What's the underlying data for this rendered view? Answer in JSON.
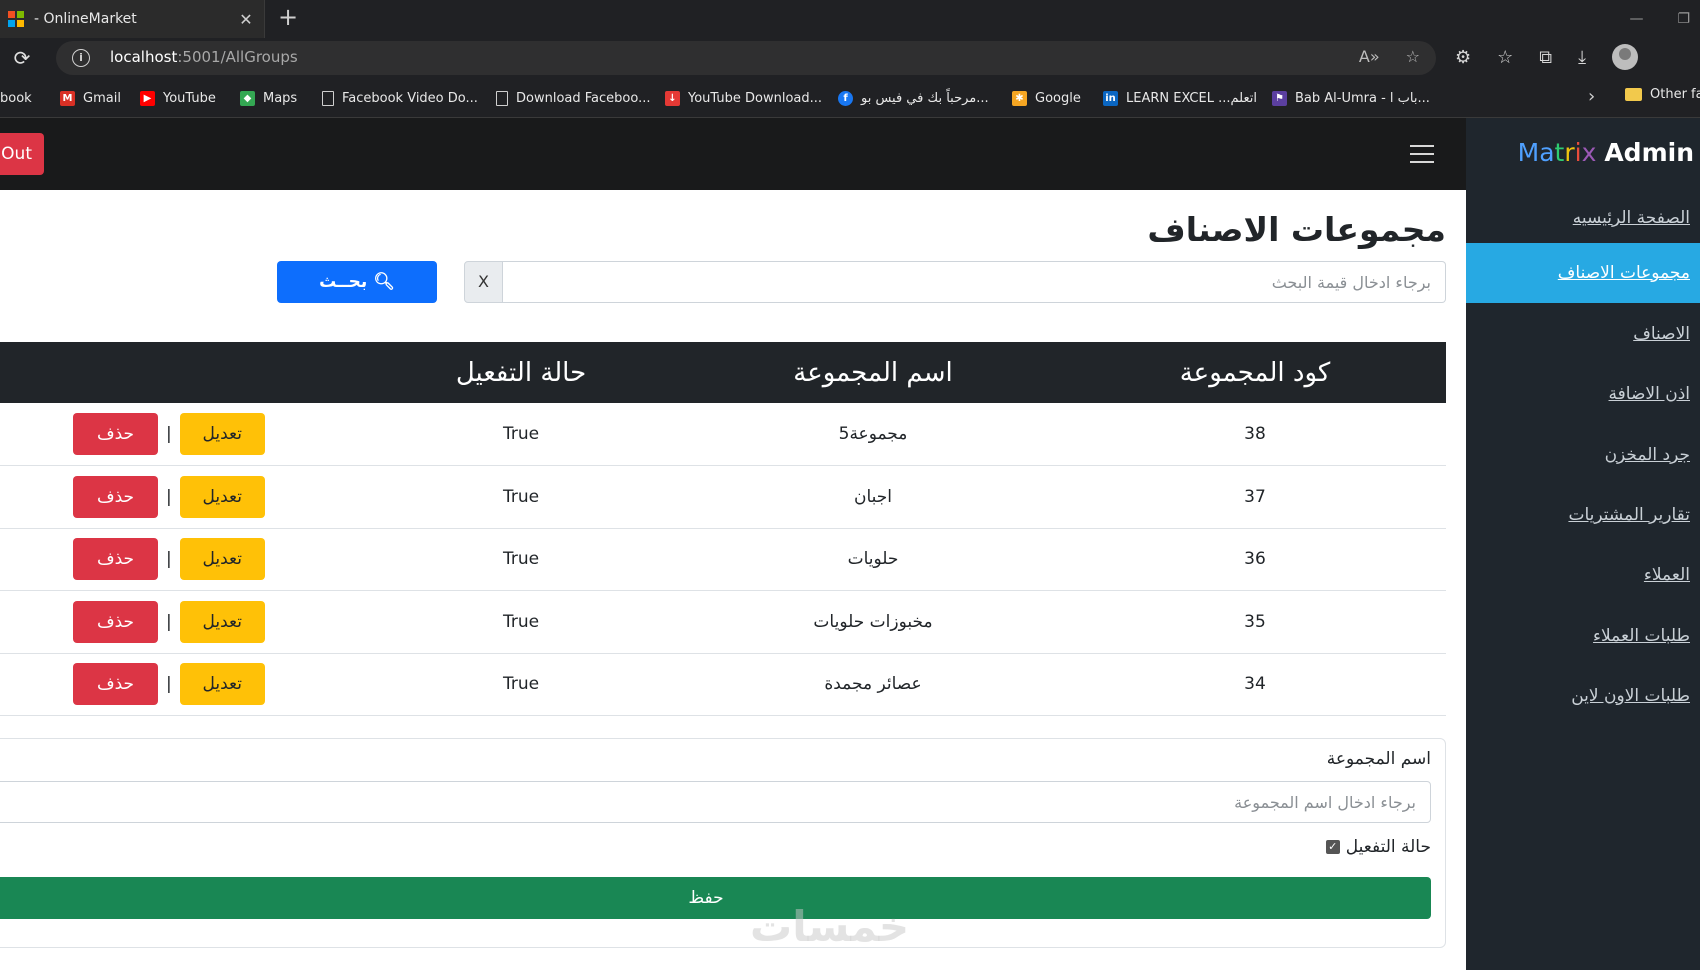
{
  "browser": {
    "tab_title": "- OnlineMarket",
    "tab_close": "✕",
    "new_tab": "+",
    "url_host": "localhost",
    "url_path": ":5001/AllGroups",
    "bookmarks": [
      {
        "label": "ebook",
        "icon": "facebook-icon"
      },
      {
        "label": "Gmail",
        "icon": "gmail-icon"
      },
      {
        "label": "YouTube",
        "icon": "youtube-icon"
      },
      {
        "label": "Maps",
        "icon": "maps-icon"
      },
      {
        "label": "Facebook Video Do...",
        "icon": "page-icon"
      },
      {
        "label": "Download Faceboo...",
        "icon": "page-icon"
      },
      {
        "label": "YouTube Download...",
        "icon": "download-icon"
      },
      {
        "label": "مرحباً بك في فيس بو...",
        "icon": "facebook-icon"
      },
      {
        "label": "Google",
        "icon": "google-icon"
      },
      {
        "label": "LEARN EXCEL ...اتعلم",
        "icon": "linkedin-icon"
      },
      {
        "label": "Bab Al-Umra - باب ا...",
        "icon": "page-icon"
      }
    ],
    "other_favorites": "Other fa"
  },
  "topnav": {
    "logout_label": "LogOut"
  },
  "sidebar": {
    "brand_letters": [
      "M",
      "a",
      "t",
      "r",
      "i",
      "x"
    ],
    "brand_admin": "Admin",
    "items": [
      {
        "label": "الصفحة الرئيسيه"
      },
      {
        "label": "مجموعات الاصناف"
      },
      {
        "label": "الاصناف"
      },
      {
        "label": "اذن الاضافة"
      },
      {
        "label": "جرد المخزن"
      },
      {
        "label": "تقارير المشتريات"
      },
      {
        "label": "العملاء"
      },
      {
        "label": "طلبات العملاء"
      },
      {
        "label": "طلبات الاون لاين"
      }
    ],
    "active_index": 1
  },
  "main": {
    "title": "مجموعات الاصناف",
    "search": {
      "placeholder": "برجاء ادخال قيمة البحث",
      "clear_label": "X",
      "button_label": "بحــث"
    },
    "table": {
      "headers": [
        "كود المجموعة",
        "اسم المجموعة",
        "حالة التفعيل"
      ],
      "rows": [
        {
          "code": "38",
          "name": "مجموعة5",
          "active": "True"
        },
        {
          "code": "37",
          "name": "اجبان",
          "active": "True"
        },
        {
          "code": "36",
          "name": "حلويات",
          "active": "True"
        },
        {
          "code": "35",
          "name": "مخبوزات حلويات",
          "active": "True"
        },
        {
          "code": "34",
          "name": "عصائر مجمدة",
          "active": "True"
        }
      ],
      "edit_label": "تعديل",
      "delete_label": "حذف",
      "separator": "|"
    },
    "form": {
      "name_label": "اسم المجموعة",
      "name_placeholder": "برجاء ادخال اسم المجموعة",
      "active_label": "حالة التفعيل",
      "active_checked": true,
      "save_label": "حفظ"
    }
  },
  "watermark": "خمسات",
  "colors": {
    "accent_active": "#27a9e3",
    "search_button": "#0d6efd",
    "edit_button": "#ffc107",
    "delete_button": "#dc3545",
    "save_button": "#198754",
    "sidebar_bg": "#1f262d"
  }
}
